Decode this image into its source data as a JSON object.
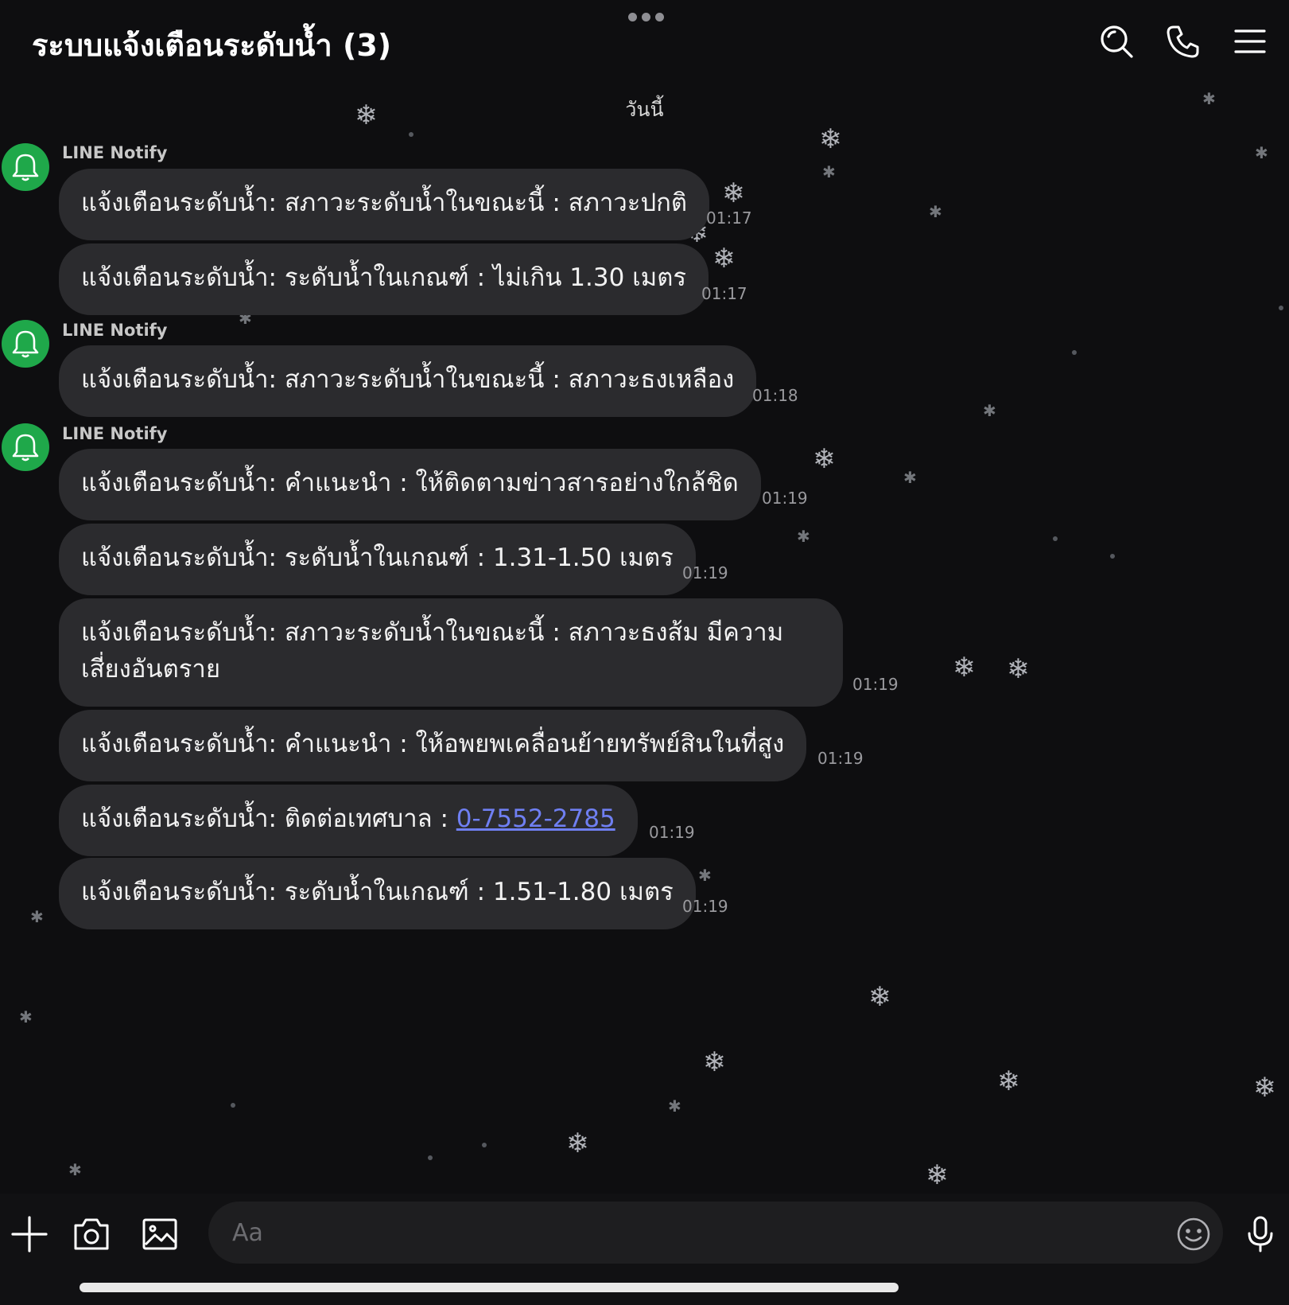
{
  "header": {
    "title": "ระบบแจ้งเตือนระดับน้ำ (3)",
    "icons": [
      "search-icon",
      "phone-icon",
      "menu-icon"
    ]
  },
  "date_separator": "วันนี้",
  "groups": [
    {
      "sender": "LINE Notify",
      "messages": [
        {
          "text": "แจ้งเตือนระดับน้ำ: สภาวะระดับน้ำในขณะนี้ : สภาวะปกติ",
          "time": "01:17"
        },
        {
          "text": "แจ้งเตือนระดับน้ำ: ระดับน้ำในเกณฑ์ : ไม่เกิน 1.30 เมตร",
          "time": "01:17"
        }
      ]
    },
    {
      "sender": "LINE Notify",
      "messages": [
        {
          "text": "แจ้งเตือนระดับน้ำ: สภาวะระดับน้ำในขณะนี้ : สภาวะธงเหลือง",
          "time": "01:18"
        }
      ]
    },
    {
      "sender": "LINE Notify",
      "messages": [
        {
          "text": "แจ้งเตือนระดับน้ำ: คำแนะนำ : ให้ติดตามข่าวสารอย่างใกล้ชิด",
          "time": "01:19"
        },
        {
          "text": "แจ้งเตือนระดับน้ำ: ระดับน้ำในเกณฑ์ : 1.31-1.50 เมตร",
          "time": "01:19"
        },
        {
          "text": "แจ้งเตือนระดับน้ำ: สภาวะระดับน้ำในขณะนี้ : สภาวะธงส้ม มีความเสี่ยงอันตราย",
          "time": "01:19"
        },
        {
          "text": "แจ้งเตือนระดับน้ำ: คำแนะนำ : ให้อพยพเคลื่อนย้ายทรัพย์สินในที่สูง",
          "time": "01:19"
        },
        {
          "text": "แจ้งเตือนระดับน้ำ: ติดต่อเทศบาล : ",
          "link": "0-7552-2785",
          "time": "01:19"
        },
        {
          "text": "แจ้งเตือนระดับน้ำ: ระดับน้ำในเกณฑ์ : 1.51-1.80 เมตร",
          "time": "01:19"
        }
      ]
    }
  ],
  "input_bar": {
    "placeholder": "Aa",
    "icons": [
      "plus-icon",
      "camera-icon",
      "image-icon",
      "emoji-icon",
      "microphone-icon"
    ]
  },
  "colors": {
    "background": "#0e0e10",
    "bubble": "#2b2b2e",
    "avatar": "#1fa84a",
    "link": "#6f7ff2"
  }
}
